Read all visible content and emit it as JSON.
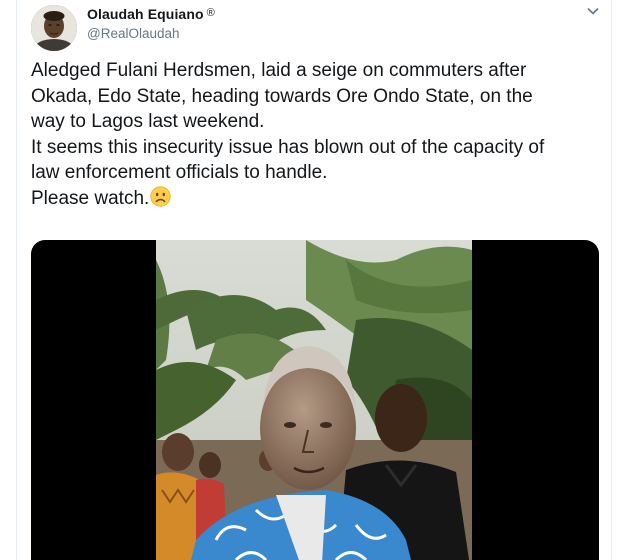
{
  "tweet": {
    "author": {
      "display_name": "Olaudah Equiano",
      "registered_mark": "®",
      "handle": "@RealOlaudah"
    },
    "menu_icon": "chevron-down-icon",
    "text_lines": [
      "Aledged Fulani Herdsmen, laid a seige on commuters after",
      "Okada, Edo State, heading towards Ore Ondo State, on the",
      "way to Lagos last weekend.",
      "It seems this insecurity issue has blown out of the capacity of",
      "law enforcement officials to handle.",
      "Please watch."
    ],
    "emoji": "frowning-face-emoji",
    "media": {
      "type": "video",
      "content": "roadside-crowd-video-frame"
    }
  },
  "colors": {
    "text_primary": "#14171a",
    "text_secondary": "#657786",
    "border": "#e6ecf0",
    "video_background": "#000000",
    "emoji_yellow": "#ffcc4d"
  }
}
